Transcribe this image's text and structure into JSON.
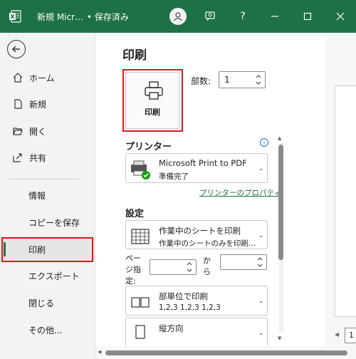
{
  "titlebar": {
    "doc_title": "新規 Micr…",
    "save_state": "• 保存済み",
    "help_label": "?",
    "colors": {
      "background": "#1e7145"
    }
  },
  "nav": {
    "items": [
      {
        "label": "ホーム",
        "icon": "home-icon"
      },
      {
        "label": "新規",
        "icon": "new-document-icon"
      },
      {
        "label": "開く",
        "icon": "folder-open-icon"
      },
      {
        "label": "共有",
        "icon": "share-icon"
      },
      {
        "label": "情報"
      },
      {
        "label": "コピーを保存"
      },
      {
        "label": "印刷",
        "active": true
      },
      {
        "label": "エクスポート"
      },
      {
        "label": "閉じる"
      },
      {
        "label": "その他..."
      }
    ]
  },
  "main": {
    "title": "印刷",
    "print_button_label": "印刷",
    "copies": {
      "label": "部数:",
      "value": "1"
    },
    "printer": {
      "header": "プリンター",
      "name": "Microsoft Print to PDF",
      "status": "準備完了",
      "properties_link": "プリンターのプロパティ"
    },
    "settings": {
      "header": "設定",
      "print_what": {
        "line1": "作業中のシートを印刷",
        "line2": "作業中のシートのみを印刷…"
      },
      "pages": {
        "label": "ページ指定:",
        "to_label": "から",
        "from_value": "",
        "to_value": ""
      },
      "collate": {
        "line1": "部単位で印刷",
        "line2": "1,2,3    1,2,3    1,2,3"
      },
      "orientation": {
        "line1": "縦方向"
      }
    }
  },
  "preview": {
    "page_number": "1"
  }
}
